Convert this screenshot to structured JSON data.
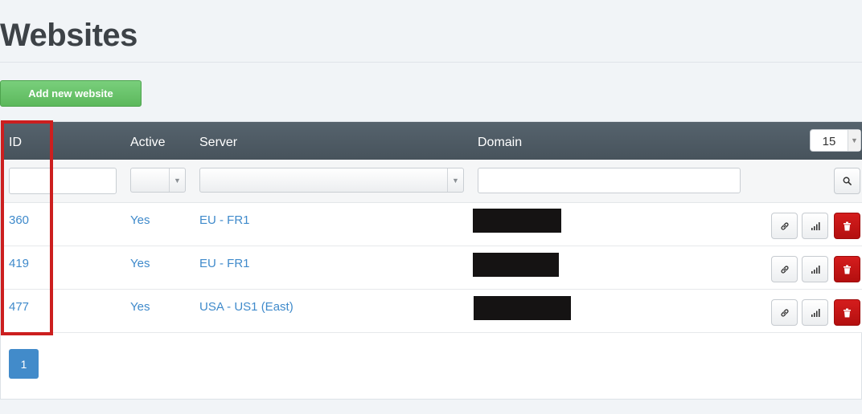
{
  "page": {
    "title": "Websites"
  },
  "toolbar": {
    "add_label": "Add new website"
  },
  "table": {
    "columns": {
      "id": "ID",
      "active": "Active",
      "server": "Server",
      "domain": "Domain"
    },
    "page_size": "15",
    "rows": [
      {
        "id": "360",
        "active": "Yes",
        "server": "EU - FR1"
      },
      {
        "id": "419",
        "active": "Yes",
        "server": "EU - FR1"
      },
      {
        "id": "477",
        "active": "Yes",
        "server": "USA - US1 (East)"
      }
    ]
  },
  "pagination": {
    "current": "1"
  },
  "colors": {
    "accent": "#428bca",
    "success": "#5cb85c",
    "danger": "#c9302c",
    "header": "#4d5a64",
    "highlight": "#cc1f1f"
  },
  "icons": {
    "row_actions": [
      "link-icon",
      "stats-icon",
      "trash-icon"
    ],
    "filter": "search-icon"
  }
}
